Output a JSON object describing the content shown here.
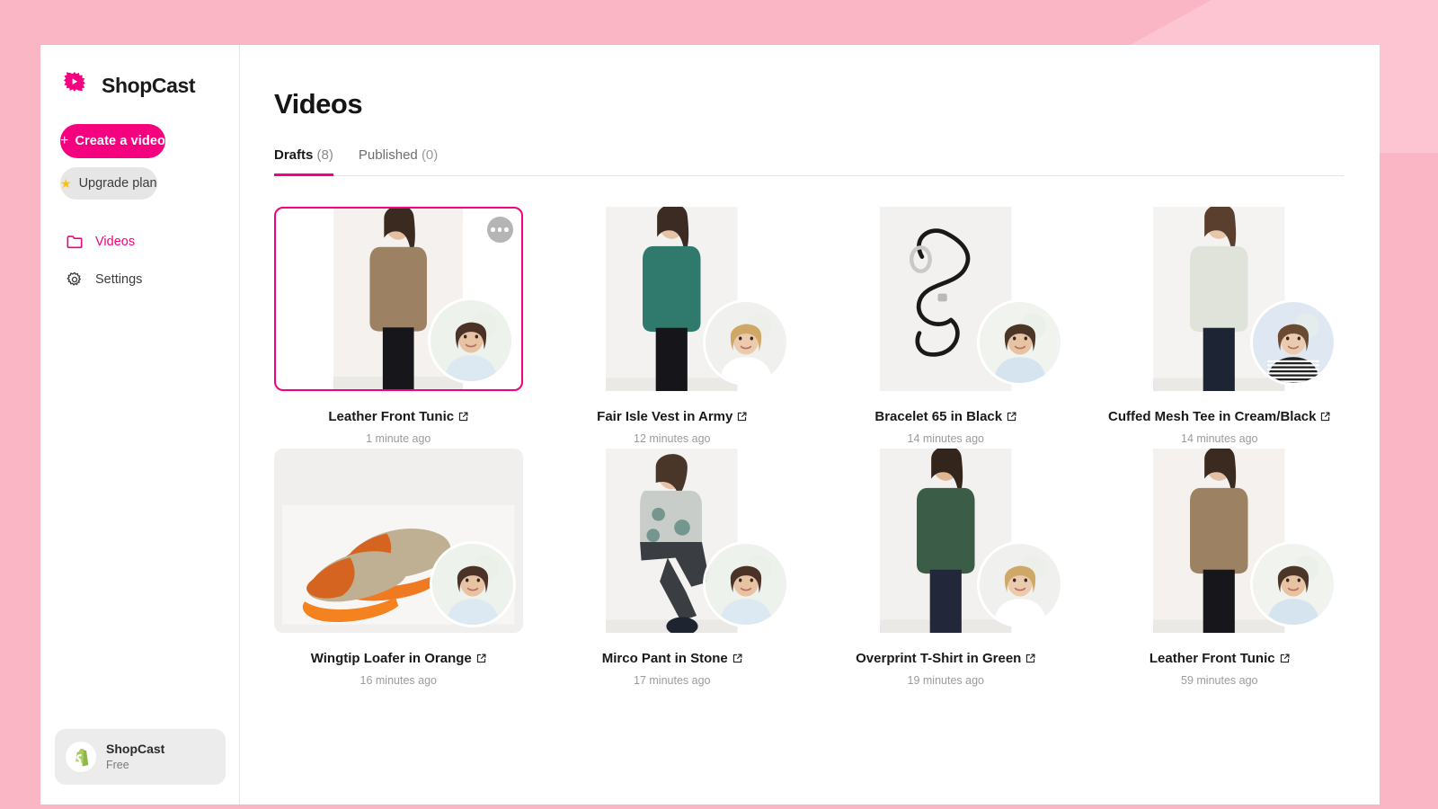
{
  "theme": {
    "brand_pink": "#F5007E",
    "page_bg": "#FBB6C6",
    "wedge": "#FCC5D1"
  },
  "sidebar": {
    "brand_name": "ShopCast",
    "brand_icon": "shopcast-burst-play-icon",
    "create_button": "Create a video",
    "create_icon": "plus-icon",
    "upgrade_button": "Upgrade plan",
    "upgrade_icon": "star-icon",
    "nav": [
      {
        "label": "Videos",
        "icon": "folder-icon",
        "active": true
      },
      {
        "label": "Settings",
        "icon": "gear-icon",
        "active": false
      }
    ],
    "store": {
      "name": "ShopCast",
      "plan": "Free",
      "icon": "shopify-bag-icon"
    }
  },
  "main": {
    "title": "Videos",
    "tabs": [
      {
        "label": "Drafts",
        "count": "(8)",
        "active": true
      },
      {
        "label": "Published",
        "count": "(0)",
        "active": false
      }
    ],
    "cards": [
      {
        "title": "Leather Front Tunic",
        "time": "1 minute ago",
        "selected": true,
        "show_menu": true,
        "menu_icon": "more-options-icon",
        "link_icon": "external-link-icon",
        "layout": "portrait",
        "product": "leather-front-tunic-brown",
        "avatar": "presenter-brunette-pointing"
      },
      {
        "title": "Fair Isle Vest in Army",
        "time": "12 minutes ago",
        "selected": false,
        "show_menu": false,
        "link_icon": "external-link-icon",
        "layout": "portrait",
        "product": "fair-isle-vest-green",
        "avatar": "presenter-blonde-smiling"
      },
      {
        "title": "Bracelet 65 in Black",
        "time": "14 minutes ago",
        "selected": false,
        "show_menu": false,
        "link_icon": "external-link-icon",
        "layout": "portrait",
        "product": "bracelet-black-cord",
        "avatar": "presenter-brunette-lightblue"
      },
      {
        "title": "Cuffed Mesh Tee in Cream/Black",
        "time": "14 minutes ago",
        "selected": false,
        "show_menu": false,
        "link_icon": "external-link-icon",
        "layout": "portrait",
        "product": "cuffed-mesh-tee-cream",
        "avatar": "presenter-striped-top"
      },
      {
        "title": "Wingtip Loafer in Orange",
        "time": "16 minutes ago",
        "selected": false,
        "show_menu": false,
        "link_icon": "external-link-icon",
        "layout": "wide",
        "product": "wingtip-loafer-orange",
        "avatar": "presenter-brunette-pointing"
      },
      {
        "title": "Mirco Pant in Stone",
        "time": "17 minutes ago",
        "selected": false,
        "show_menu": false,
        "link_icon": "external-link-icon",
        "layout": "portrait",
        "product": "mirco-pant-stone",
        "avatar": "presenter-brunette-pointing"
      },
      {
        "title": "Overprint T-Shirt in Green",
        "time": "19 minutes ago",
        "selected": false,
        "show_menu": false,
        "link_icon": "external-link-icon",
        "layout": "portrait",
        "product": "overprint-tshirt-green",
        "avatar": "presenter-blonde-smiling"
      },
      {
        "title": "Leather Front Tunic",
        "time": "59 minutes ago",
        "selected": false,
        "show_menu": false,
        "link_icon": "external-link-icon",
        "layout": "portrait",
        "product": "leather-front-tunic-brown",
        "avatar": "presenter-brunette-lightblue"
      }
    ]
  }
}
